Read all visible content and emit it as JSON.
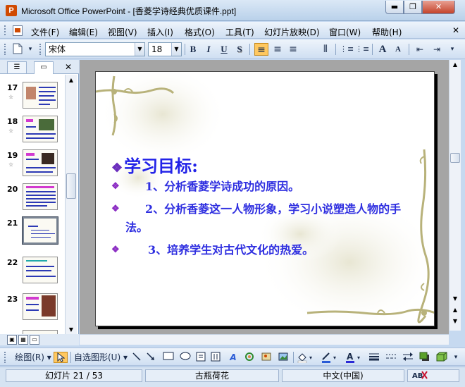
{
  "window": {
    "title": "Microsoft Office PowerPoint - [香菱学诗经典优质课件.ppt]",
    "app_icon_letter": "P",
    "min": "▬",
    "max": "❐",
    "close": "✕"
  },
  "menu": {
    "items": [
      "文件(F)",
      "编辑(E)",
      "视图(V)",
      "插入(I)",
      "格式(O)",
      "工具(T)",
      "幻灯片放映(D)",
      "窗口(W)",
      "帮助(H)"
    ],
    "close_glyph": "✕"
  },
  "toolbar": {
    "font_name": "宋体",
    "font_size": "18",
    "bold": "B",
    "italic": "I",
    "underline": "U",
    "shadow": "S",
    "align_left": "≡",
    "align_center": "≡",
    "align_right": "≡",
    "distribute": "⫴",
    "numbering": "⋮≡",
    "bullets": "⋮≡",
    "grow": "A",
    "shrink": "A",
    "dec_indent": "⇤",
    "inc_indent": "⇥",
    "icons": [
      "new-doc-icon",
      "bold-icon",
      "italic-icon",
      "underline-icon",
      "shadow-icon",
      "align-left-icon",
      "align-center-icon",
      "align-right-icon",
      "distribute-icon",
      "numbering-icon",
      "bullets-icon",
      "grow-font-icon",
      "shrink-font-icon",
      "decrease-indent-icon",
      "increase-indent-icon"
    ]
  },
  "left_pane": {
    "tab_outline": "☰",
    "tab_slides": "▭",
    "close": "✕",
    "star": "☆",
    "slides": [
      {
        "num": "17",
        "has_star": true,
        "selected": false
      },
      {
        "num": "18",
        "has_star": true,
        "selected": false
      },
      {
        "num": "19",
        "has_star": true,
        "selected": false
      },
      {
        "num": "20",
        "has_star": false,
        "selected": false
      },
      {
        "num": "21",
        "has_star": false,
        "selected": true
      },
      {
        "num": "22",
        "has_star": false,
        "selected": false
      },
      {
        "num": "23",
        "has_star": false,
        "selected": false
      }
    ]
  },
  "slide": {
    "heading": "学习目标:",
    "bullet": "❖",
    "items": [
      "1、分析香菱学诗成功的原因。",
      "2、分析香菱这一人物形象，学习小说塑造人物的手法。",
      "3、培养学生对古代文化的热爱。"
    ],
    "colors": {
      "heading": "#2323e8",
      "text": "#2f2fe0",
      "bullet": "#8b2cc3",
      "vine": "#b8b27a"
    }
  },
  "drawbar": {
    "draw_label": "绘图(R)",
    "autoshape_label": "自选图形(U)",
    "icons": [
      "select-arrow-icon",
      "line-icon",
      "arrow-icon",
      "rectangle-icon",
      "oval-icon",
      "textbox-icon",
      "vertical-textbox-icon",
      "wordart-icon",
      "diagram-icon",
      "clipart-icon",
      "picture-icon",
      "fill-color-icon",
      "line-color-icon",
      "font-color-icon",
      "line-style-icon",
      "dash-style-icon",
      "arrow-style-icon",
      "shadow-style-icon",
      "3d-style-icon"
    ]
  },
  "status": {
    "slide_info": "幻灯片 21 / 53",
    "design": "古瓶荷花",
    "language": "中文(中国)"
  },
  "scroll": {
    "up": "▲",
    "down": "▼",
    "left": "◀",
    "right": "▶",
    "prev": "▲",
    "next": "▼"
  }
}
